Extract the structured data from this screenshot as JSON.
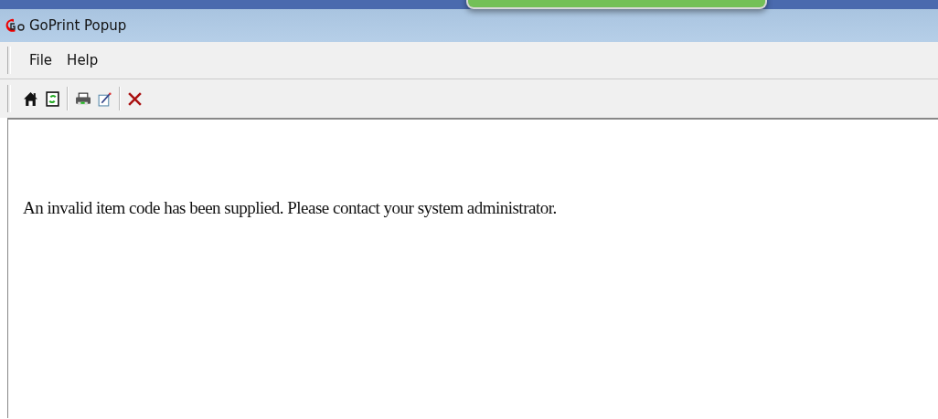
{
  "window": {
    "title": "GoPrint Popup"
  },
  "menu": [
    {
      "label": "File"
    },
    {
      "label": "Help"
    }
  ],
  "toolbar": [
    {
      "kind": "home"
    },
    {
      "kind": "refresh"
    },
    {
      "kind": "separator"
    },
    {
      "kind": "print"
    },
    {
      "kind": "edit"
    },
    {
      "kind": "separator"
    },
    {
      "kind": "close"
    }
  ],
  "message": "An invalid item code has been supplied. Please contact your system administrator."
}
